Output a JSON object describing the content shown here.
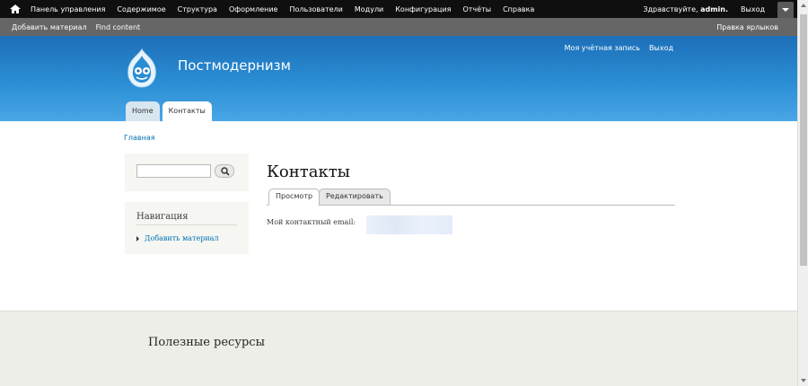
{
  "toolbar": {
    "home_icon": "home-icon",
    "menu": [
      "Панель управления",
      "Содержимое",
      "Структура",
      "Оформление",
      "Пользователи",
      "Модули",
      "Конфигурация",
      "Отчёты",
      "Справка"
    ],
    "greeting_prefix": "Здравствуйте,",
    "username": "admin.",
    "logout": "Выход"
  },
  "shortcuts": {
    "items": [
      "Добавить материал",
      "Find content"
    ],
    "edit": "Правка ярлыков"
  },
  "header": {
    "site_name": "Постмодернизм",
    "secondary_menu": [
      "Моя учётная запись",
      "Выход"
    ],
    "main_tabs": [
      "Home",
      "Контакты"
    ],
    "colors": {
      "top": "#1d6fb8",
      "bottom": "#4aa6e6"
    }
  },
  "breadcrumb": "Главная",
  "sidebar": {
    "search_placeholder": "",
    "nav_title": "Навигация",
    "nav_items": [
      "Добавить материал"
    ]
  },
  "main": {
    "title": "Контакты",
    "tabs": [
      "Просмотр",
      "Редактировать"
    ],
    "contact_label": "Мой контактный email:"
  },
  "footer": {
    "title": "Полезные ресурсы"
  }
}
